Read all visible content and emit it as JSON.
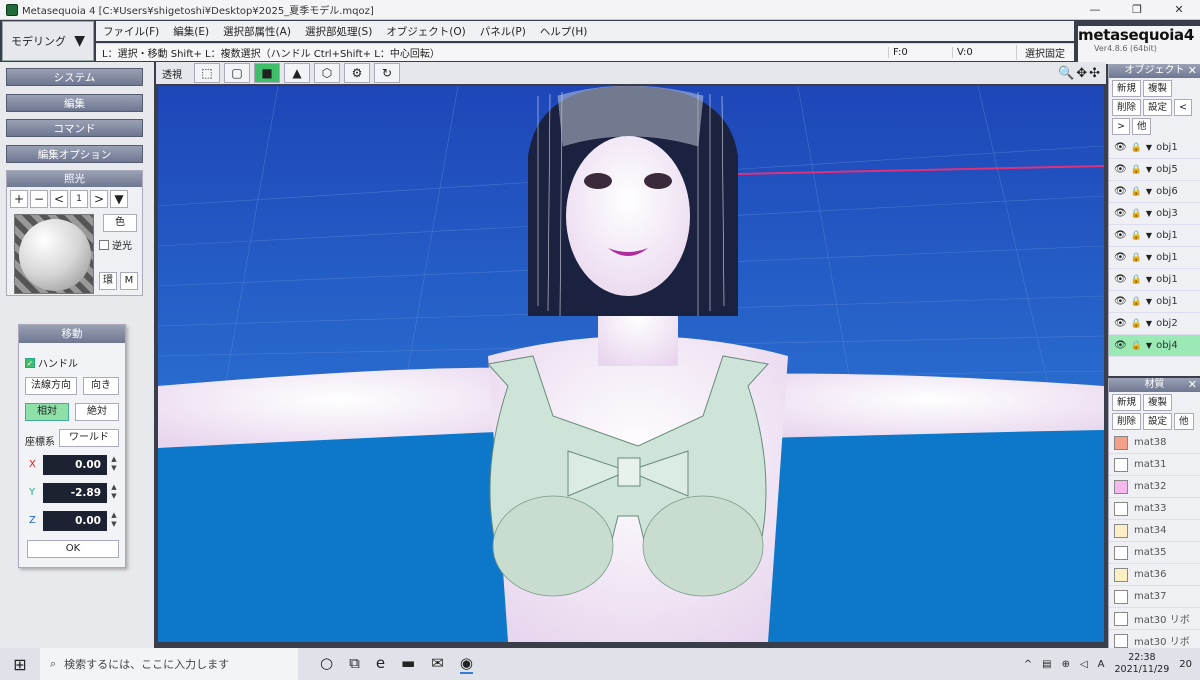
{
  "window": {
    "title": "Metasequoia 4 [C:¥Users¥shigetoshi¥Desktop¥2025_夏季モデル.mqoz]",
    "minimize": "—",
    "restore": "❐",
    "close": "✕"
  },
  "mode": {
    "label": "モデリング",
    "arrow": "▼"
  },
  "menu": [
    "ファイル(F)",
    "編集(E)",
    "選択部属性(A)",
    "選択部処理(S)",
    "オブジェクト(O)",
    "パネル(P)",
    "ヘルプ(H)"
  ],
  "status": {
    "hint": "L：選択・移動  Shift+ L：複数選択（ハンドル  Ctrl+Shift+ L：中心回転）",
    "faces": "F:0",
    "verts": "V:0",
    "lock": "選択固定"
  },
  "logo": {
    "name": "metasequoia4",
    "version": "Ver4.8.6 (64bit)"
  },
  "left": {
    "system": "システム",
    "edit": "編集",
    "command": "コマンド",
    "edit_option": "編集オプション",
    "light": {
      "title": "照光",
      "index": "1",
      "color": "色",
      "reverse": "逆光",
      "env": "環",
      "m": "M"
    }
  },
  "move": {
    "title": "移動",
    "handle": "ハンドル",
    "normal": "法線方向",
    "direction": "向き",
    "relative": "相対",
    "absolute": "絶対",
    "coord_label": "座標系",
    "coord": "ワールド",
    "x_label": "X",
    "x": "0.00",
    "y_label": "Y",
    "y": "-2.89",
    "z_label": "Z",
    "z": "0.00",
    "ok": "OK"
  },
  "viewtool": {
    "transparent": "透視"
  },
  "objects": {
    "title": "オブジェクト",
    "buttons": [
      "新規",
      "複製",
      "削除",
      "設定",
      "<",
      ">",
      "他"
    ],
    "rows": [
      "obj1",
      "obj5",
      "obj6",
      "obj3",
      "obj1",
      "obj1",
      "obj1",
      "obj1",
      "obj2",
      "obj4"
    ]
  },
  "materials": {
    "title": "材質",
    "buttons": [
      "新規",
      "複製",
      "削除",
      "設定",
      "他"
    ],
    "rows": [
      {
        "name": "mat38",
        "color": "#f4a089"
      },
      {
        "name": "mat31",
        "color": "#ffffff"
      },
      {
        "name": "mat32",
        "color": "#f6b6ee"
      },
      {
        "name": "mat33",
        "color": "#ffffff"
      },
      {
        "name": "mat34",
        "color": "#fbeec8"
      },
      {
        "name": "mat35",
        "color": "#ffffff"
      },
      {
        "name": "mat36",
        "color": "#fbf0c2"
      },
      {
        "name": "mat37",
        "color": "#ffffff"
      },
      {
        "name": "mat30 リボ",
        "color": "#ffffff"
      },
      {
        "name": "mat30 リボ",
        "color": "#ffffff"
      }
    ]
  },
  "taskbar": {
    "search_placeholder": "検索するには、ここに入力します",
    "time": "22:38",
    "date": "2021/11/29",
    "notif": "20"
  },
  "colors": {
    "viewport": "#0e64b8",
    "accent": "#3fbf6a"
  }
}
